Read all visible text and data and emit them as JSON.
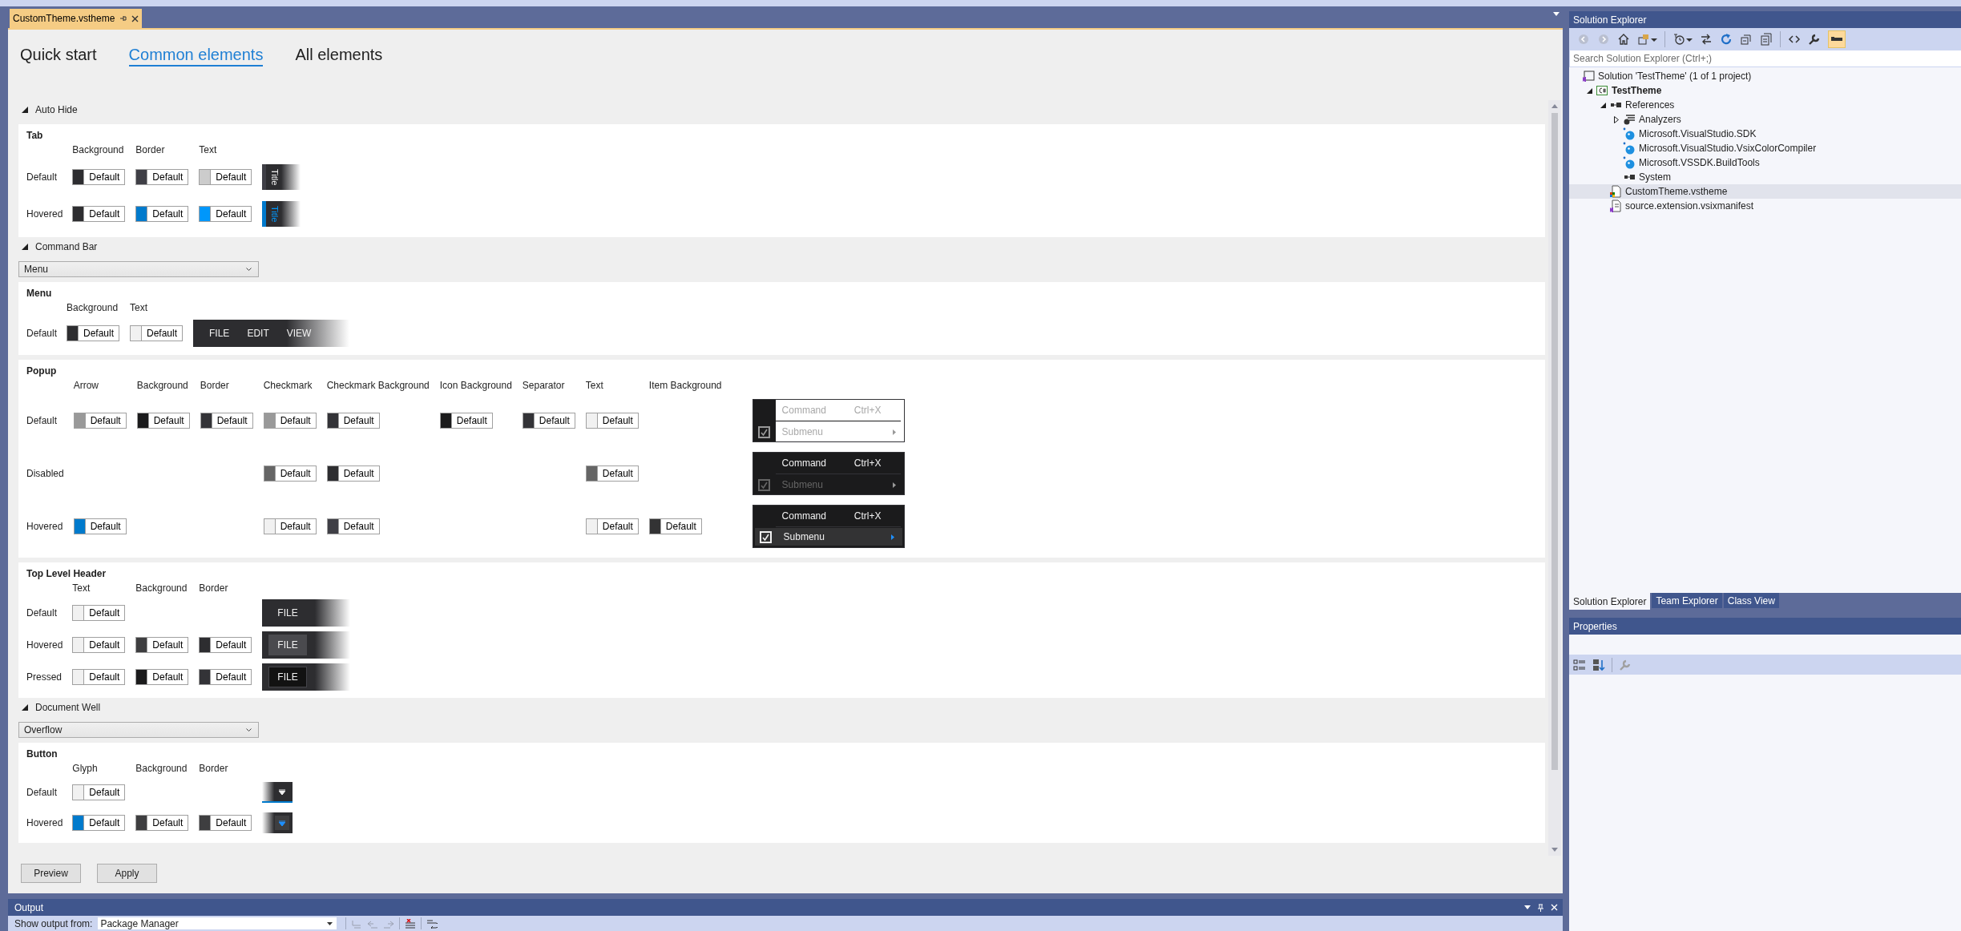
{
  "document_tab": {
    "title": "CustomTheme.vstheme",
    "selected": true
  },
  "editor": {
    "nav": [
      {
        "label": "Quick start",
        "selected": false
      },
      {
        "label": "Common elements",
        "selected": true
      },
      {
        "label": "All elements",
        "selected": false
      }
    ],
    "sections": [
      {
        "title": "Auto Hide",
        "expanded": true,
        "panels": [
          {
            "title": "Tab",
            "columns": [
              "Background",
              "Border",
              "Text"
            ],
            "rows": [
              {
                "label": "Default",
                "cells": [
                  {
                    "color": "#2d2d30",
                    "value": "Default"
                  },
                  {
                    "color": "#3f3f46",
                    "value": "Default"
                  },
                  {
                    "color": "#cccccc",
                    "value": "Default"
                  }
                ],
                "preview": {
                  "kind": "vertical-tab",
                  "hovered": false,
                  "text": "Title"
                }
              },
              {
                "label": "Hovered",
                "cells": [
                  {
                    "color": "#2d2d30",
                    "value": "Default"
                  },
                  {
                    "color": "#007acc",
                    "value": "Default"
                  },
                  {
                    "color": "#0097fb",
                    "value": "Default"
                  }
                ],
                "preview": {
                  "kind": "vertical-tab",
                  "hovered": true,
                  "text": "Title"
                }
              }
            ]
          }
        ]
      },
      {
        "title": "Command Bar",
        "expanded": true,
        "dropdown": "Menu",
        "panels": [
          {
            "title": "Menu",
            "columns": [
              "Background",
              "Text"
            ],
            "rows": [
              {
                "label": "Default",
                "cells": [
                  {
                    "color": "#2d2d30",
                    "value": "Default"
                  },
                  {
                    "color": "#f1f1f1",
                    "value": "Default"
                  }
                ],
                "preview": {
                  "kind": "menu-bar",
                  "items": [
                    "FILE",
                    "EDIT",
                    "VIEW"
                  ]
                }
              }
            ]
          },
          {
            "title": "Popup",
            "columns": [
              "Arrow",
              "Background",
              "Border",
              "Checkmark",
              "Checkmark Background",
              "Icon Background",
              "Separator",
              "Text",
              "Item Background"
            ],
            "rows": [
              {
                "label": "Default",
                "cells": [
                  {
                    "color": "#999999",
                    "value": "Default"
                  },
                  {
                    "color": "#1b1b1c",
                    "value": "Default"
                  },
                  {
                    "color": "#333337",
                    "value": "Default"
                  },
                  {
                    "color": "#999999",
                    "value": "Default"
                  },
                  {
                    "color": "#333337",
                    "value": "Default"
                  },
                  {
                    "color": "#1b1b1c",
                    "value": "Default"
                  },
                  {
                    "color": "#333337",
                    "value": "Default"
                  },
                  {
                    "color": "#f1f1f1",
                    "value": "Default"
                  },
                  null
                ],
                "preview": {
                  "kind": "popup-menu",
                  "disabled": false,
                  "hovered": false,
                  "command": "Command",
                  "shortcut": "Ctrl+X",
                  "submenu": "Submenu",
                  "checked": true
                }
              },
              {
                "label": "Disabled",
                "cells": [
                  null,
                  null,
                  null,
                  {
                    "color": "#656565",
                    "value": "Default"
                  },
                  {
                    "color": "#2d2d30",
                    "value": "Default"
                  },
                  null,
                  null,
                  {
                    "color": "#656565",
                    "value": "Default"
                  },
                  null
                ],
                "preview": {
                  "kind": "popup-menu",
                  "disabled": true,
                  "hovered": false,
                  "command": "Command",
                  "shortcut": "Ctrl+X",
                  "submenu": "Submenu",
                  "checked": true
                }
              },
              {
                "label": "Hovered",
                "cells": [
                  {
                    "color": "#007acc",
                    "value": "Default"
                  },
                  null,
                  null,
                  {
                    "color": "#f1f1f1",
                    "value": "Default"
                  },
                  {
                    "color": "#3f3f46",
                    "value": "Default"
                  },
                  null,
                  null,
                  {
                    "color": "#f1f1f1",
                    "value": "Default"
                  },
                  {
                    "color": "#333334",
                    "value": "Default"
                  }
                ],
                "preview": {
                  "kind": "popup-menu",
                  "disabled": false,
                  "hovered": true,
                  "command": "Command",
                  "shortcut": "Ctrl+X",
                  "submenu": "Submenu",
                  "checked": true
                }
              }
            ]
          },
          {
            "title": "Top Level Header",
            "columns": [
              "Text",
              "Background",
              "Border"
            ],
            "rows": [
              {
                "label": "Default",
                "cells": [
                  {
                    "color": "#f1f1f1",
                    "value": "Default"
                  },
                  null,
                  null
                ],
                "preview": {
                  "kind": "header-button",
                  "hovered": false,
                  "pressed": false,
                  "text": "FILE"
                }
              },
              {
                "label": "Hovered",
                "cells": [
                  {
                    "color": "#f1f1f1",
                    "value": "Default"
                  },
                  {
                    "color": "#3e3e40",
                    "value": "Default"
                  },
                  {
                    "color": "#2d2d30",
                    "value": "Default"
                  }
                ],
                "preview": {
                  "kind": "header-button",
                  "hovered": true,
                  "pressed": false,
                  "text": "FILE"
                }
              },
              {
                "label": "Pressed",
                "cells": [
                  {
                    "color": "#f1f1f1",
                    "value": "Default"
                  },
                  {
                    "color": "#1b1b1c",
                    "value": "Default"
                  },
                  {
                    "color": "#333337",
                    "value": "Default"
                  }
                ],
                "preview": {
                  "kind": "header-button",
                  "hovered": false,
                  "pressed": true,
                  "text": "FILE"
                }
              }
            ]
          }
        ]
      },
      {
        "title": "Document Well",
        "expanded": true,
        "dropdown": "Overflow",
        "panels": [
          {
            "title": "Button",
            "columns": [
              "Glyph",
              "Background",
              "Border"
            ],
            "rows": [
              {
                "label": "Default",
                "cells": [
                  {
                    "color": "#f1f1f1",
                    "value": "Default"
                  },
                  null,
                  null
                ],
                "preview": {
                  "kind": "overflow-button",
                  "hovered": false
                }
              },
              {
                "label": "Hovered",
                "cells": [
                  {
                    "color": "#007acc",
                    "value": "Default"
                  },
                  {
                    "color": "#3e3e40",
                    "value": "Default"
                  },
                  {
                    "color": "#3e3e40",
                    "value": "Default"
                  }
                ],
                "preview": {
                  "kind": "overflow-button",
                  "hovered": true
                }
              }
            ]
          }
        ]
      }
    ],
    "buttons": [
      "Preview",
      "Apply"
    ]
  },
  "output": {
    "title": "Output",
    "label": "Show output from:",
    "source": "Package Manager"
  },
  "solution_explorer": {
    "title": "Solution Explorer",
    "preview_toggle": {
      "on": true
    },
    "search": {
      "placeholder": "Search Solution Explorer (Ctrl+;)"
    },
    "tree": [
      {
        "label": "Solution 'TestTheme' (1 of 1 project)",
        "kind": "solution",
        "selected": false,
        "children": [
          {
            "label": "TestTheme",
            "kind": "project",
            "expanded": true,
            "selected": false,
            "children": [
              {
                "label": "References",
                "kind": "references",
                "expanded": true,
                "selected": false,
                "children": [
                  {
                    "label": "Analyzers",
                    "kind": "analyzers",
                    "expanded": false,
                    "selected": false
                  },
                  {
                    "label": "Microsoft.VisualStudio.SDK",
                    "kind": "package",
                    "selected": false
                  },
                  {
                    "label": "Microsoft.VisualStudio.VsixColorCompiler",
                    "kind": "package",
                    "selected": false
                  },
                  {
                    "label": "Microsoft.VSSDK.BuildTools",
                    "kind": "package",
                    "selected": false
                  },
                  {
                    "label": "System",
                    "kind": "assembly",
                    "selected": false
                  }
                ]
              },
              {
                "label": "CustomTheme.vstheme",
                "kind": "theme",
                "selected": true
              },
              {
                "label": "source.extension.vsixmanifest",
                "kind": "manifest",
                "selected": false
              }
            ]
          }
        ]
      }
    ]
  },
  "tool_tabs": [
    {
      "label": "Solution Explorer",
      "selected": true
    },
    {
      "label": "Team Explorer",
      "selected": false
    },
    {
      "label": "Class View",
      "selected": false
    }
  ],
  "properties": {
    "title": "Properties"
  }
}
